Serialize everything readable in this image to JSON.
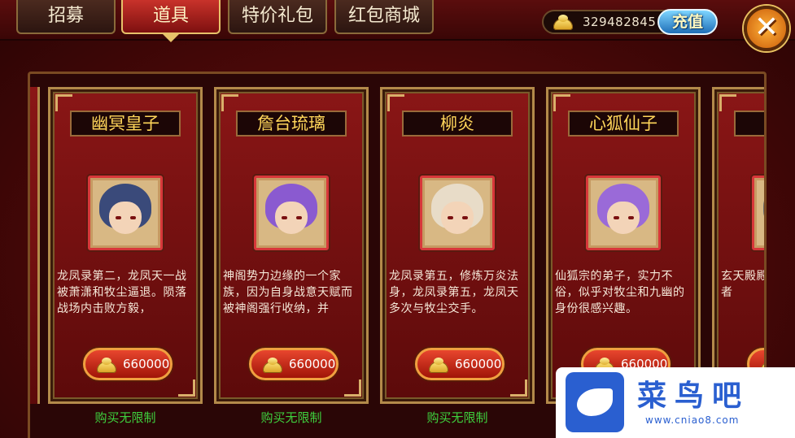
{
  "tabs": [
    {
      "label": "招募",
      "active": false
    },
    {
      "label": "道具",
      "active": true
    },
    {
      "label": "特价礼包",
      "active": false
    },
    {
      "label": "红包商城",
      "active": false
    }
  ],
  "currency": {
    "amount": "329482845",
    "icon": "gold-ingot-icon",
    "recharge_label": "充值"
  },
  "close": {
    "icon": "close-icon",
    "symbol": "✕"
  },
  "cards": [
    {
      "title": "幽冥皇子",
      "description": "龙凤录第二，龙凤天一战被萧潇和牧尘逼退。陨落战场内击败方毅，",
      "price": "660000",
      "note": "购买无限制",
      "hair_color": "#3a4a7a"
    },
    {
      "title": "詹台琉璃",
      "description": "神阁势力边缘的一个家族，因为自身战意天赋而被神阁强行收纳，并",
      "price": "660000",
      "note": "购买无限制",
      "hair_color": "#8a5ad0"
    },
    {
      "title": "柳炎",
      "description": "龙凤录第五，修炼万炎法身，龙凤录第五，龙凤天多次与牧尘交手。",
      "price": "660000",
      "note": "购买无限制",
      "hair_color": "#e8dcc8"
    },
    {
      "title": "心狐仙子",
      "description": "仙狐宗的弟子，实力不俗，似乎对牧尘和九幽的身份很感兴趣。",
      "price": "660000",
      "note": "",
      "hair_color": "#9a6ad8"
    },
    {
      "title": "",
      "description": "玄天殿殿至尊，天名的强者",
      "price": "",
      "note": "",
      "hair_color": "#6a6a6a"
    }
  ],
  "watermark": {
    "title": "菜鸟吧",
    "url": "www.cniao8.com"
  },
  "colors": {
    "accent_gold": "#ffd65a",
    "note_green": "#3ed13e",
    "tab_active": "#c8322a"
  }
}
